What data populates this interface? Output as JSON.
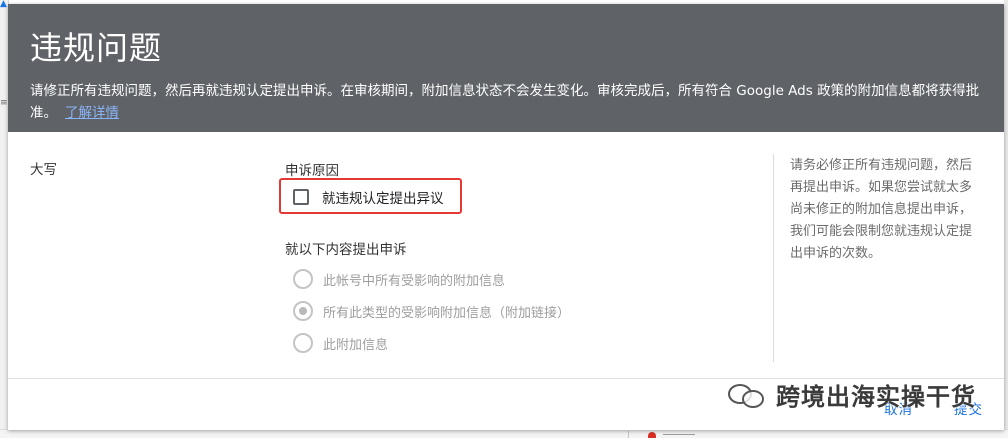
{
  "dialog": {
    "title": "违规问题",
    "description": "请修正所有违规问题，然后再就违规认定提出申诉。在审核期间，附加信息状态不会发生变化。审核完成后，所有符合 Google Ads 政策的附加信息都将获得批准。",
    "learn_more": "了解详情"
  },
  "body": {
    "field_label": "大写",
    "appeal_reason": {
      "heading": "申诉原因",
      "checkbox_label": "就违规认定提出异议",
      "checked": false
    },
    "appeal_scope": {
      "heading": "就以下内容提出申诉",
      "options": [
        {
          "label": "此帐号中所有受影响的附加信息",
          "selected": false
        },
        {
          "label": "所有此类型的受影响附加信息（附加链接）",
          "selected": true
        },
        {
          "label": "此附加信息",
          "selected": false
        }
      ]
    },
    "side_note": "请务必修正所有违规问题，然后再提出申诉。如果您尝试就太多尚未修正的附加信息提出申诉，我们可能会限制您就违规认定提出申诉的次数。"
  },
  "footer": {
    "cancel_label": "取消",
    "submit_label": "提交"
  },
  "watermark": {
    "text": "跨境出海实操干货"
  },
  "colors": {
    "header_bg": "#5f6368",
    "link": "#1a73e8",
    "highlight": "#e53935"
  }
}
